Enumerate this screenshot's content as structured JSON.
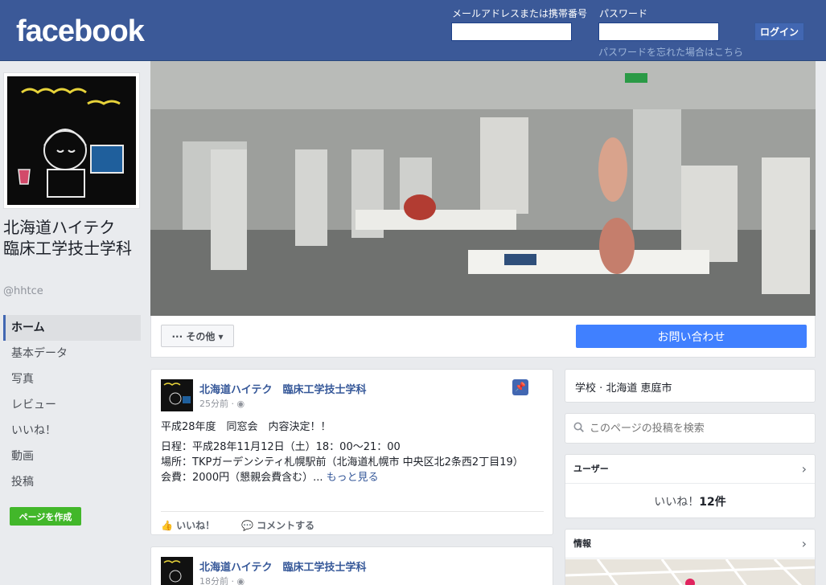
{
  "header": {
    "logo": "facebook",
    "email_label": "メールアドレスまたは携帯番号",
    "password_label": "パスワード",
    "email_value": "",
    "password_value": "",
    "login_button": "ログイン",
    "forgot_link": "パスワードを忘れた場合はこちら"
  },
  "page": {
    "name": "北海道ハイテク　臨床工学技士学科",
    "handle": "@hhtce"
  },
  "nav": {
    "items": [
      "ホーム",
      "基本データ",
      "写真",
      "レビュー",
      "いいね！",
      "動画",
      "投稿"
    ],
    "create_page": "ページを作成"
  },
  "actionbar": {
    "more": "··· その他 ▾",
    "contact": "お問い合わせ"
  },
  "posts": [
    {
      "author": "北海道ハイテク　臨床工学技士学科",
      "time": "25分前 · ◉",
      "lines": [
        "平成28年度　同窓会　内容決定！！",
        "日程：平成28年11月12日（土）18：00〜21：00",
        "場所：TKPガーデンシティ札幌駅前（北海道札幌市 中央区北2条西2丁目19）",
        "会費：2000円（懇親会費含む）..."
      ],
      "more_link": "もっと見る",
      "like": "いいね！",
      "comment": "コメントする"
    },
    {
      "author": "北海道ハイテク　臨床工学技士学科",
      "time": "18分前 · ◉"
    }
  ],
  "sidebar": {
    "category": "学校 · 北海道 恵庭市",
    "search_placeholder": "このページの投稿を検索",
    "users_heading": "ユーザー",
    "likes_prefix": "いいね！",
    "likes_count": "12件",
    "info_heading": "情報"
  },
  "colors": {
    "brand": "#3b5998",
    "button_blue": "#4080ff",
    "create_green": "#42b72a"
  }
}
